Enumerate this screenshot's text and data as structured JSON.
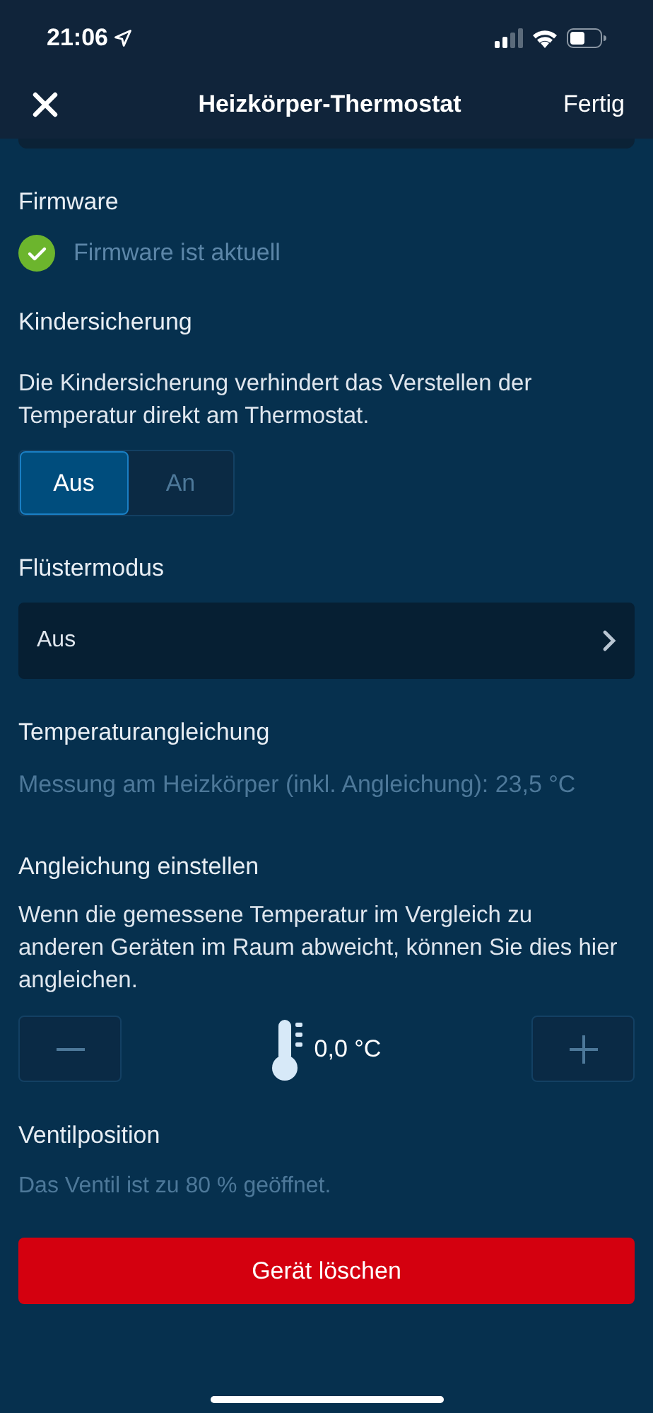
{
  "status_bar": {
    "time": "21:06"
  },
  "nav": {
    "title": "Heizkörper-Thermostat",
    "done": "Fertig"
  },
  "firmware": {
    "heading": "Firmware",
    "status": "Firmware ist aktuell",
    "up_to_date": true
  },
  "child_lock": {
    "heading": "Kindersicherung",
    "description": "Die Kindersicherung verhindert das Verstellen der Temperatur direkt am Thermostat.",
    "options": [
      {
        "label": "Aus",
        "selected": true
      },
      {
        "label": "An",
        "selected": false
      }
    ]
  },
  "whisper_mode": {
    "heading": "Flüstermodus",
    "value": "Aus"
  },
  "temperature_adjustment": {
    "heading": "Temperaturangleichung",
    "measurement": "Messung am Heizkörper (inkl. Angleichung): 23,5 °C"
  },
  "offset": {
    "heading": "Angleichung einstellen",
    "description": "Wenn die gemessene Temperatur im Vergleich zu anderen Geräten im Raum abweicht, können Sie dies hier angleichen.",
    "value": "0,0 °C"
  },
  "valve": {
    "heading": "Ventilposition",
    "text": "Das Ventil ist zu 80 % geöffnet."
  },
  "delete_button": "Gerät löschen"
}
